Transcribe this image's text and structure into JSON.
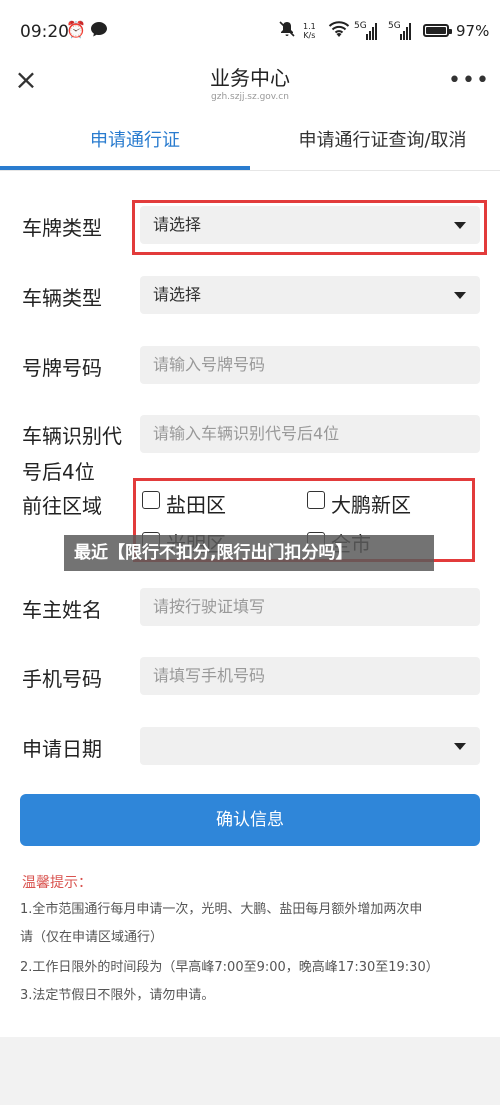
{
  "status_bar": {
    "time": "09:20",
    "speed_value": "1.1",
    "speed_unit": "K/s",
    "sim1": "5G",
    "sim2": "5G",
    "battery": "97%",
    "icons": [
      "alarm-icon",
      "message-icon",
      "mute-icon",
      "wifi-icon",
      "signal-icon",
      "battery-icon"
    ]
  },
  "header": {
    "title": "业务中心",
    "subtitle": "gzh.szjj.sz.gov.cn",
    "close_icon": "×",
    "more_icon": "•••"
  },
  "tabs": [
    {
      "label": "申请通行证",
      "active": true
    },
    {
      "label": "申请通行证查询/取消",
      "active": false
    }
  ],
  "form": {
    "plate_type": {
      "label": "车牌类型",
      "value": "请选择"
    },
    "vehicle_type": {
      "label": "车辆类型",
      "value": "请选择"
    },
    "plate_number": {
      "label": "号牌号码",
      "placeholder": "请输入号牌号码"
    },
    "vin": {
      "label_line1": "车辆识别代",
      "label_line2": "号后4位",
      "placeholder": "请输入车辆识别代号后4位"
    },
    "destination": {
      "label": "前往区域",
      "options": [
        "盐田区",
        "大鹏新区",
        "光明区",
        "全市"
      ]
    },
    "owner": {
      "label": "车主姓名",
      "placeholder": "请按行驶证填写"
    },
    "phone": {
      "label": "手机号码",
      "placeholder": "请填写手机号码"
    },
    "date": {
      "label": "申请日期",
      "value": ""
    }
  },
  "overlay_banner": "最近【限行不扣分,限行出门扣分吗】",
  "confirm_button": "确认信息",
  "notice": {
    "title": "温馨提示：",
    "line1a": "1.全市范围通行每月申请一次，光明、大鹏、盐田每月额外增加两次申",
    "line1b": "请（仅在申请区域通行）",
    "line2": "2.工作日限外的时间段为（早高峰7:00至9:00，晚高峰17:30至19:30）",
    "line3": "3.法定节假日不限外，请勿申请。"
  },
  "colors": {
    "accent": "#2a7ccf",
    "button": "#2f86d9",
    "highlight_box": "#e23b3b",
    "notice_title": "#d9534f"
  }
}
